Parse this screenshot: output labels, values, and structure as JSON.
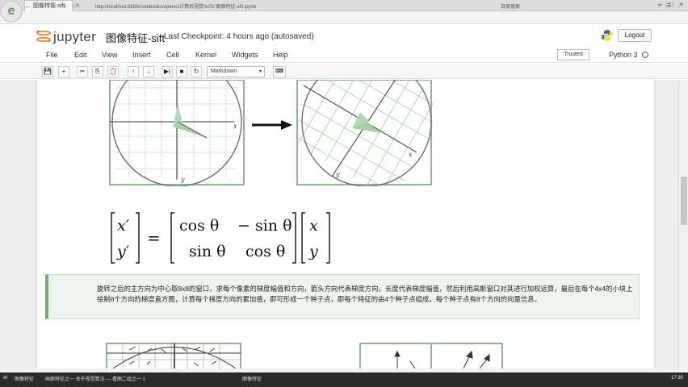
{
  "browser": {
    "logo_letter": "e",
    "tab_title": "图像特征-sift",
    "tab_close": "×",
    "window_controls": [
      "–",
      "□",
      "×"
    ],
    "nav": [
      "←",
      "→",
      "↻",
      "⌂",
      "☆"
    ],
    "url": "http://localhost:8888/notebooks/opencv计算机视觉%20/ 图像特征-sift.ipynb",
    "url_extra": "百度搜索",
    "addr_icons": [
      "⚡",
      "☰",
      "⋮"
    ]
  },
  "jupyter": {
    "brand": "jupyter",
    "notebook_title": "图像特征-sift",
    "checkpoint": "Last Checkpoint: 4 hours ago (autosaved)",
    "logout": "Logout",
    "menu": [
      "File",
      "Edit",
      "View",
      "Insert",
      "Cell",
      "Kernel",
      "Widgets",
      "Help"
    ],
    "trusted": "Trusted",
    "kernel": "Python 3",
    "toolbar": [
      "💾",
      "+",
      "✂",
      "⎘",
      "📋",
      "↑",
      "↓",
      "▶|",
      "■",
      "↻"
    ],
    "cell_type": "Markdown",
    "cell_type_caret": "▾",
    "keyboard_icon": "⌨"
  },
  "figure": {
    "left_axis_x": "x",
    "left_axis_y": "y",
    "right_axis_x": "x",
    "right_axis_y": "y"
  },
  "formula": {
    "lhs_top": "x′",
    "lhs_bottom": "y′",
    "equals": "=",
    "m11": "cos θ",
    "m12": "− sin θ",
    "m21": "sin θ",
    "m22": "cos θ",
    "rhs_top": "x",
    "rhs_bottom": "y"
  },
  "text_cell": {
    "content": "旋转之后的主方向为中心取8x8的窗口，求每个像素的梯度幅值和方向，箭头方向代表梯度方向，长度代表梯度幅值，然后利用高斯窗口对其进行加权运算，最后在每个4x4的小块上绘制8个方向的梯度直方图，计算每个梯度方向的累加值，即可形成一个种子点，即每个特征的由4个种子点组成，每个种子点有8个方向的向量信息。"
  },
  "taskbar": {
    "items": [
      "⊞",
      "图像特征",
      "画面特征之一 关于视觉算法 — 看图二组之一 1",
      "图像特征"
    ],
    "clock": "17:35"
  }
}
